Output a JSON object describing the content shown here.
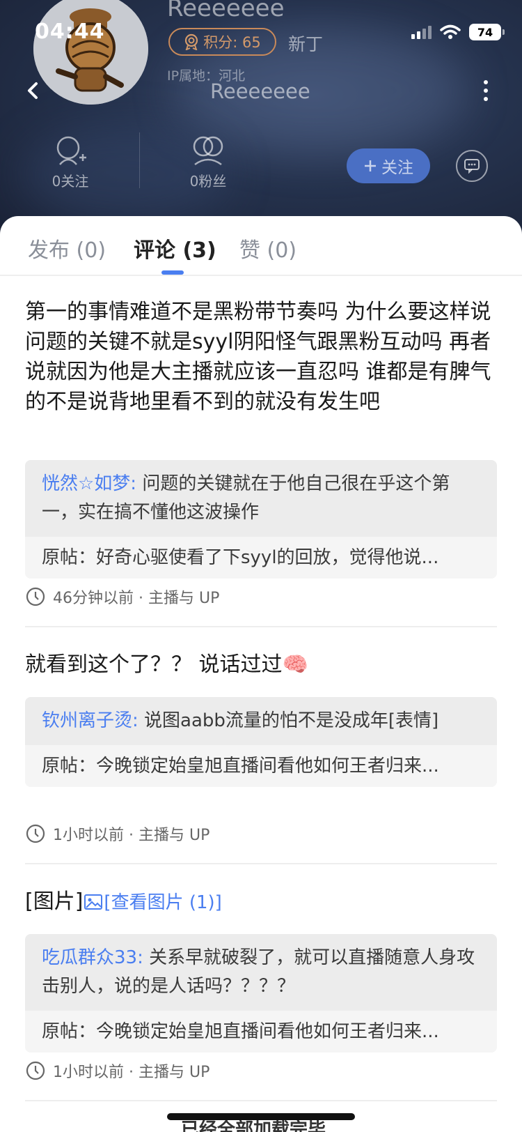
{
  "status_bar": {
    "time": "04:44",
    "battery": "74"
  },
  "profile": {
    "name_top": "Reeeeeee",
    "name_center": "Reeeeeee",
    "score": "积分: 65",
    "level": "新丁",
    "ip": "IP属地：河北",
    "following": "0关注",
    "followers": "0粉丝",
    "follow_button": "关注"
  },
  "tabs": [
    {
      "label": "发布 (0)"
    },
    {
      "label": "评论 (3)"
    },
    {
      "label": "赞 (0)"
    }
  ],
  "comments": [
    {
      "text": "第一的事情难道不是黑粉带节奏吗  为什么要这样说  问题的关键不就是syyl阴阳怪气跟黑粉互动吗  再者说就因为他是大主播就应该一直忍吗  谁都是有脾气的不是说背地里看不到的就没有发生吧",
      "reply_user": "恍然☆如梦:",
      "reply_text": "问题的关键就在于他自己很在乎这个第一，实在搞不懂他这波操作",
      "orig_post": "原帖：好奇心驱使看了下syyl的回放，觉得他说...",
      "meta": "46分钟以前 · 主播与 UP"
    },
    {
      "text": "就看到这个了？？ 说话过过🧠",
      "reply_user": "钦州离子烫:",
      "reply_text": "说图aabb流量的怕不是没成年[表情]",
      "orig_post": "原帖：今晚锁定始皇旭直播间看他如何王者归来...",
      "meta": "1小时以前 · 主播与 UP"
    },
    {
      "text": "[图片]",
      "image_link": "[查看图片 (1)]",
      "reply_user": "吃瓜群众33:",
      "reply_text": "关系早就破裂了，就可以直播随意人身攻击别人，说的是人话吗？？？？",
      "orig_post": "原帖：今晚锁定始皇旭直播间看他如何王者归来...",
      "meta": "1小时以前 · 主播与 UP"
    }
  ],
  "footer": "已经全部加载完毕",
  "colors": {
    "accent": "#4a7ef0",
    "header_bg": "#25324d",
    "badge": "#c98a5a"
  }
}
